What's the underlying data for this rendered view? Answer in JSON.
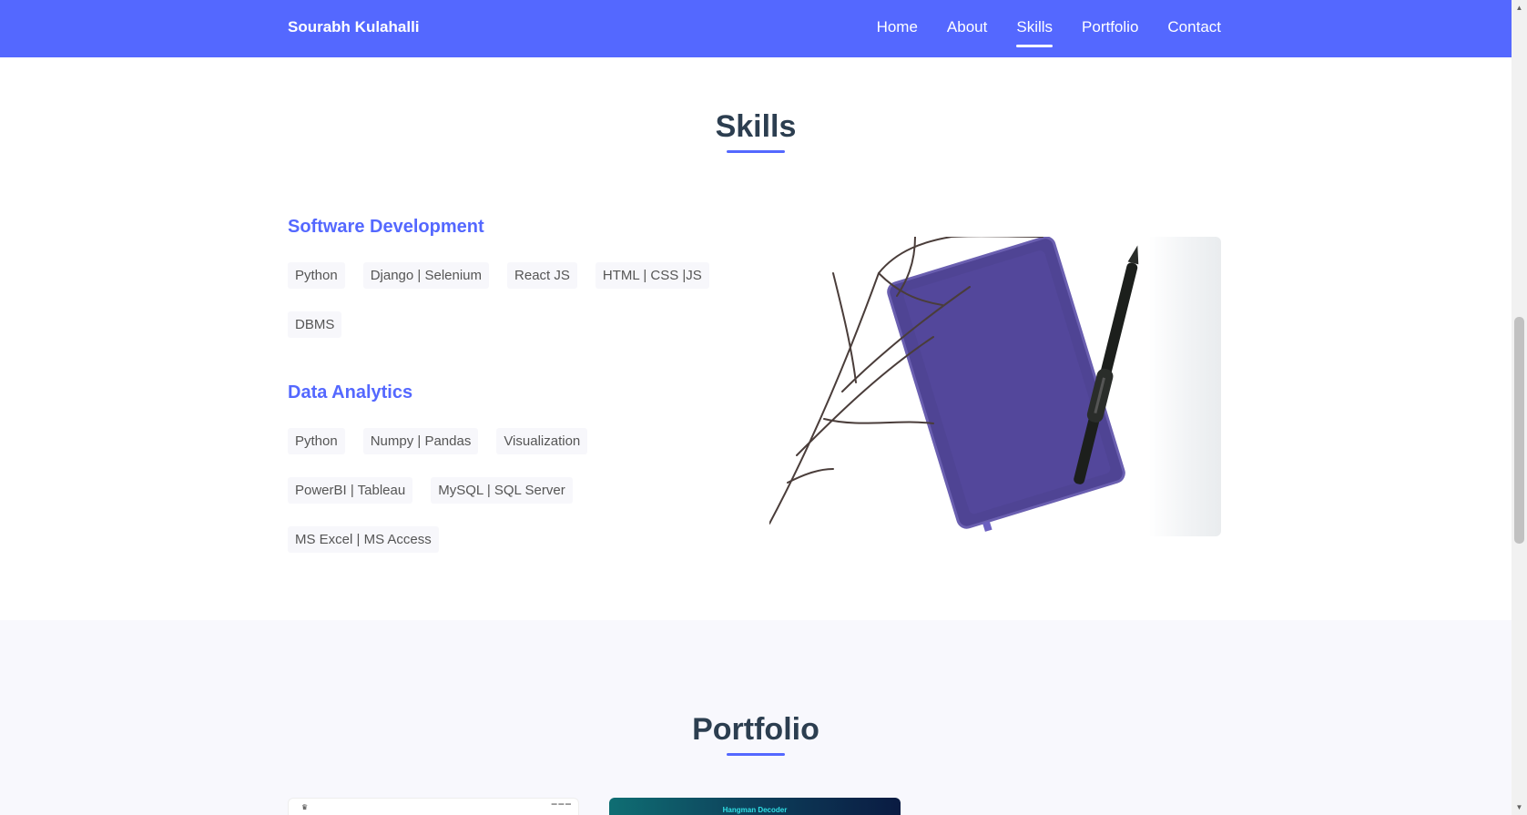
{
  "navbar": {
    "brand": "Sourabh Kulahalli",
    "links": [
      "Home",
      "About",
      "Skills",
      "Portfolio",
      "Contact"
    ],
    "active": "Skills"
  },
  "skills": {
    "title": "Skills",
    "categories": [
      {
        "heading": "Software Development",
        "tags": [
          "Python",
          "Django | Selenium",
          "React JS",
          "HTML | CSS |JS",
          "DBMS"
        ]
      },
      {
        "heading": "Data Analytics",
        "tags": [
          "Python",
          "Numpy | Pandas",
          "Visualization",
          "PowerBI | Tableau",
          "MySQL | SQL Server",
          "MS Excel | MS Access"
        ]
      }
    ],
    "image": "notebook-pen-branch-photo"
  },
  "portfolio": {
    "title": "Portfolio",
    "card_2_caption": "Hangman Decoder"
  },
  "colors": {
    "primary": "#5468ff",
    "heading": "#2c3e50",
    "tag_bg": "#f7f7fb",
    "section_alt_bg": "#f8f8fd"
  }
}
